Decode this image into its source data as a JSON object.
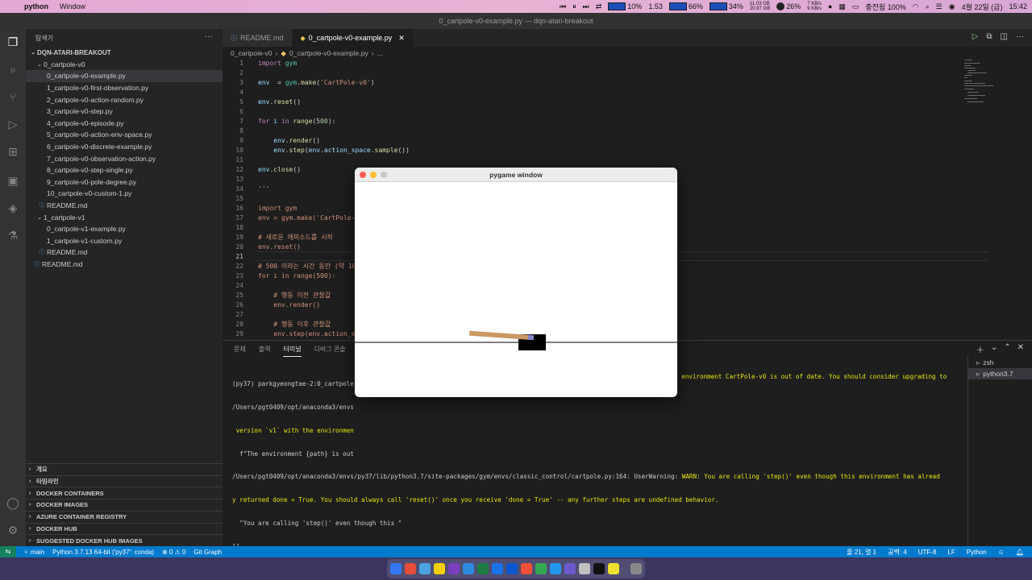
{
  "menubar": {
    "app_name": "python",
    "menu_items": [
      "Window"
    ],
    "status": {
      "cpu": "10%",
      "load": "1.53",
      "mem": "66%",
      "disk": "34%",
      "disk_used": "11.03 GB",
      "disk_free": "20.97 GB",
      "weather": "26%",
      "net_up": "7 KB/s",
      "net_down": "9 KB/s",
      "battery": "충전됨 100%",
      "date": "4월 22일 (금)",
      "time": "15:42"
    }
  },
  "window_title": "0_cartpole-v0-example.py — dqn-atari-breakout",
  "sidebar": {
    "header": "탐색기",
    "root": "DQN-ATARI-BREAKOUT",
    "folder1": "0_cartpole-v0",
    "files1": [
      "0_cartpole-v0-example.py",
      "1_cartpole-v0-first-observation.py",
      "2_cartpole-v0-action-random.py",
      "3_cartpole-v0-step.py",
      "4_cartpole-v0-episode.py",
      "5_cartpole-v0-action-env-space.py",
      "6_cartpole-v0-discrete-example.py",
      "7_cartpole-v0-observation-action.py",
      "8_cartpole-v0-step-single.py",
      "9_cartpole-v0-pole-degree.py",
      "10_cartpole-v0-custom-1.py",
      "README.md"
    ],
    "folder2": "1_cartpole-v1",
    "files2": [
      "0_cartpole-v1-example.py",
      "1_cartpole-v1-custom.py",
      "README.md"
    ],
    "root_readme": "README.md",
    "sections": [
      "개요",
      "타임라인",
      "DOCKER CONTAINERS",
      "DOCKER IMAGES",
      "AZURE CONTAINER REGISTRY",
      "DOCKER HUB",
      "SUGGESTED DOCKER HUB IMAGES"
    ]
  },
  "tabs": [
    {
      "label": "README.md"
    },
    {
      "label": "0_cartpole-v0-example.py"
    }
  ],
  "breadcrumb": {
    "folder": "0_cartpole-v0",
    "file": "0_cartpole-v0-example.py",
    "tail": "..."
  },
  "editor": {
    "current_line": "21",
    "lines": [
      {
        "n": "1",
        "tokens": [
          [
            "kw",
            "import "
          ],
          [
            "md",
            "gym"
          ]
        ]
      },
      {
        "n": "2",
        "tokens": []
      },
      {
        "n": "3",
        "tokens": [
          [
            "vr",
            "env"
          ],
          [
            "",
            "  = "
          ],
          [
            "md",
            "gym"
          ],
          [
            "",
            "."
          ],
          [
            "fn",
            "make"
          ],
          [
            "",
            "("
          ],
          [
            "str",
            "'CartPole-v0'"
          ],
          [
            "",
            ")"
          ]
        ]
      },
      {
        "n": "4",
        "tokens": []
      },
      {
        "n": "5",
        "tokens": [
          [
            "vr",
            "env"
          ],
          [
            "",
            "."
          ],
          [
            "fn",
            "reset"
          ],
          [
            "",
            "()"
          ]
        ]
      },
      {
        "n": "6",
        "tokens": []
      },
      {
        "n": "7",
        "tokens": [
          [
            "kw",
            "for "
          ],
          [
            "vr",
            "i"
          ],
          [
            "kw",
            " in "
          ],
          [
            "fn",
            "range"
          ],
          [
            "",
            "("
          ],
          [
            "nm",
            "500"
          ],
          [
            "",
            "):"
          ]
        ]
      },
      {
        "n": "8",
        "tokens": []
      },
      {
        "n": "9",
        "tokens": [
          [
            "",
            "    "
          ],
          [
            "vr",
            "env"
          ],
          [
            "",
            "."
          ],
          [
            "fn",
            "render"
          ],
          [
            "",
            "()"
          ]
        ]
      },
      {
        "n": "10",
        "tokens": [
          [
            "",
            "    "
          ],
          [
            "vr",
            "env"
          ],
          [
            "",
            "."
          ],
          [
            "fn",
            "step"
          ],
          [
            "",
            "("
          ],
          [
            "vr",
            "env"
          ],
          [
            "",
            "."
          ],
          [
            "vr",
            "action_space"
          ],
          [
            "",
            "."
          ],
          [
            "fn",
            "sample"
          ],
          [
            "",
            "())"
          ]
        ]
      },
      {
        "n": "11",
        "tokens": []
      },
      {
        "n": "12",
        "tokens": [
          [
            "vr",
            "env"
          ],
          [
            "",
            "."
          ],
          [
            "fn",
            "close"
          ],
          [
            "",
            "()"
          ]
        ]
      },
      {
        "n": "13",
        "tokens": []
      },
      {
        "n": "14",
        "tokens": [
          [
            "str",
            "'''"
          ]
        ]
      },
      {
        "n": "15",
        "tokens": []
      },
      {
        "n": "16",
        "tokens": [
          [
            "str",
            "import gym"
          ]
        ]
      },
      {
        "n": "17",
        "tokens": [
          [
            "str",
            "env = gym.make('CartPole-"
          ]
        ]
      },
      {
        "n": "18",
        "tokens": []
      },
      {
        "n": "19",
        "tokens": [
          [
            "str",
            "# 새로운 에피소드를 시작"
          ]
        ]
      },
      {
        "n": "20",
        "tokens": [
          [
            "str",
            "env.reset()"
          ]
        ]
      },
      {
        "n": "21",
        "tokens": []
      },
      {
        "n": "22",
        "tokens": [
          [
            "str",
            "# 500 이라는 시간 동안 (약 10s"
          ]
        ]
      },
      {
        "n": "23",
        "tokens": [
          [
            "str",
            "for i in range(500):"
          ]
        ]
      },
      {
        "n": "24",
        "tokens": []
      },
      {
        "n": "25",
        "tokens": [
          [
            "str",
            "    # 행동 이전 관찰값"
          ]
        ]
      },
      {
        "n": "26",
        "tokens": [
          [
            "str",
            "    env.render()"
          ]
        ]
      },
      {
        "n": "27",
        "tokens": []
      },
      {
        "n": "28",
        "tokens": [
          [
            "str",
            "    # 행동 이후 관찰값"
          ]
        ]
      },
      {
        "n": "29",
        "tokens": [
          [
            "str",
            "    env.step(env.action_s"
          ]
        ]
      }
    ]
  },
  "panel": {
    "tabs": [
      "문제",
      "출력",
      "터미널",
      "디버그 콘솔"
    ],
    "active_tab": "터미널",
    "terminal_lines": [
      "(py37) parkgyeongtae-2:0_cartpole",
      "/Users/pgt0409/opt/anaconda3/envs",
      " version `v1` with the environmen",
      "  f\"The environment {path} is out",
      "/Users/pgt0409/opt/anaconda3/envs/py37/lib/python3.7/site-packages/gym/envs/classic_control/cartpole.py:164: UserWarning:",
      "y returned done = True. You should always call 'reset()' once you receive 'done = True' -- any further steps are undefined behavior.",
      "  \"You are calling 'step()' even though this \"",
      "[]"
    ],
    "terminal_warn_right": "e environment CartPole-v0 is out of date. You should consider upgrading to",
    "terminal_warn_line5": "WARN: You are calling 'step()' even though this environment has alread",
    "terminals": [
      "zsh",
      "python3.7"
    ]
  },
  "statusbar": {
    "branch": "main",
    "interpreter": "Python 3.7.13 64-bit ('py37': conda)",
    "problems": "⊗ 0 ⚠ 0",
    "git_graph": "Git Graph",
    "position": "줄 21, 열 1",
    "spaces": "공백: 4",
    "encoding": "UTF-8",
    "eol": "LF",
    "language": "Python"
  },
  "pygame": {
    "title": "pygame window",
    "pole_angle_deg": 4,
    "colors": {
      "cart": "#000000",
      "pole": "#ca9865",
      "axle": "#8184cb",
      "track": "#000000"
    }
  },
  "colors": {
    "accent": "#007acc",
    "remote": "#16825d"
  }
}
